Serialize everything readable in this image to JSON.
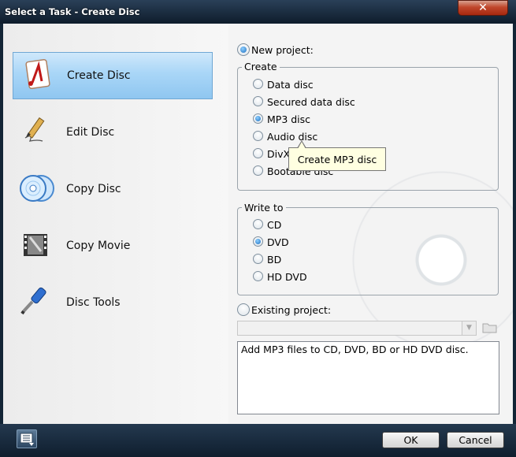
{
  "window": {
    "title": "Select a Task - Create Disc"
  },
  "tasks": [
    {
      "label": "Create Disc",
      "selected": true,
      "icon": "create-disc-icon"
    },
    {
      "label": "Edit Disc",
      "selected": false,
      "icon": "pen-icon"
    },
    {
      "label": "Copy Disc",
      "selected": false,
      "icon": "copy-disc-icon"
    },
    {
      "label": "Copy Movie",
      "selected": false,
      "icon": "film-icon"
    },
    {
      "label": "Disc Tools",
      "selected": false,
      "icon": "screwdriver-icon"
    }
  ],
  "new_project": {
    "label": "New project:",
    "selected": true
  },
  "create": {
    "legend": "Create",
    "options": [
      {
        "label": "Data disc",
        "selected": false
      },
      {
        "label": "Secured data disc",
        "selected": false
      },
      {
        "label": "MP3 disc",
        "selected": true
      },
      {
        "label": "Audio disc",
        "selected": false
      },
      {
        "label": "DivX",
        "selected": false
      },
      {
        "label": "Bootable disc",
        "selected": false
      }
    ]
  },
  "tooltip": {
    "text": "Create MP3 disc"
  },
  "write_to": {
    "legend": "Write to",
    "options": [
      {
        "label": "CD",
        "selected": false
      },
      {
        "label": "DVD",
        "selected": true
      },
      {
        "label": "BD",
        "selected": false
      },
      {
        "label": "HD DVD",
        "selected": false
      }
    ]
  },
  "existing_project": {
    "label": "Existing project:",
    "selected": false,
    "value": ""
  },
  "description": "Add MP3 files to CD, DVD, BD or HD DVD disc.",
  "buttons": {
    "ok": "OK",
    "cancel": "Cancel"
  },
  "colors": {
    "selected_task": "#a9d6f7",
    "titlebar": "#1a2d42",
    "close": "#c0472c",
    "tooltip_bg": "#ffffe1"
  }
}
